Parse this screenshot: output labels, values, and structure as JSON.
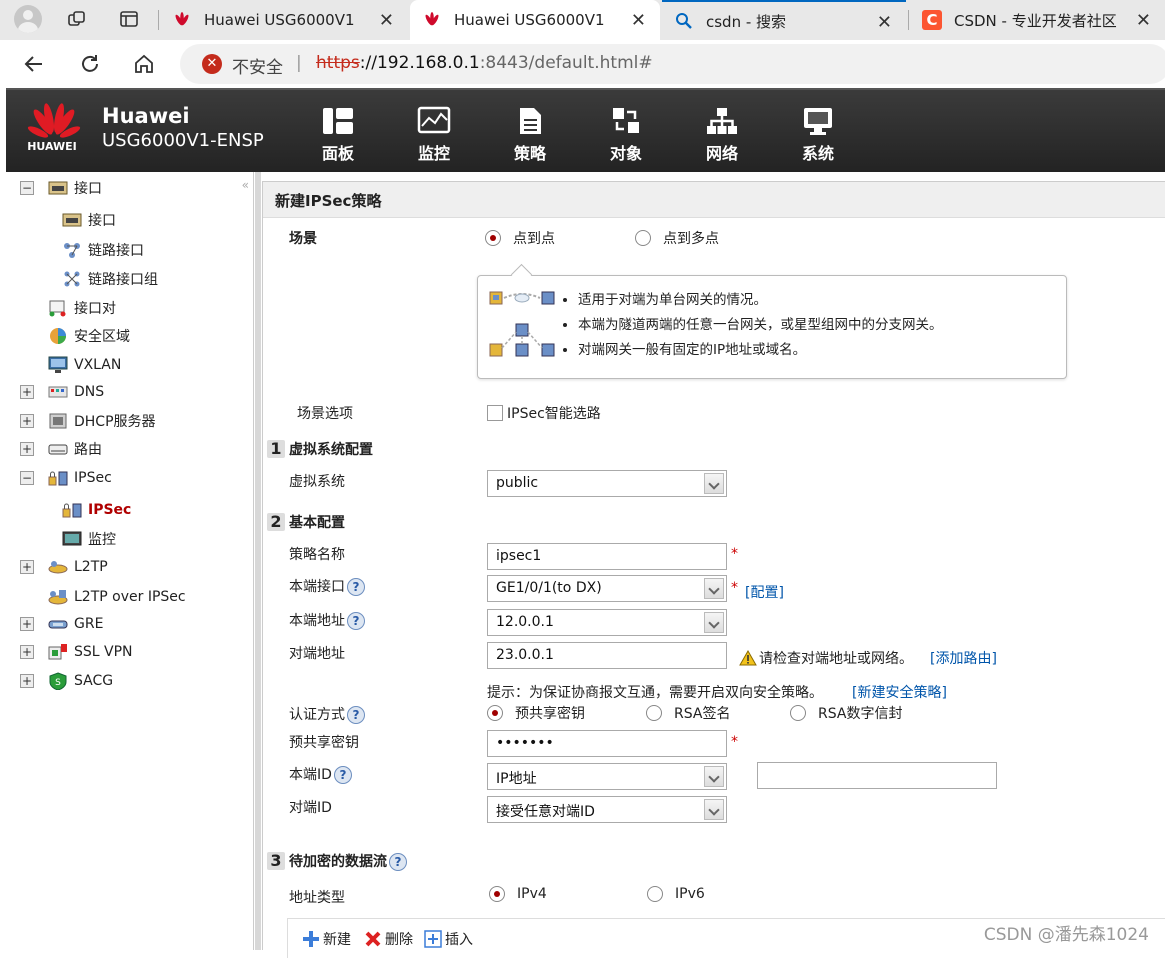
{
  "browser": {
    "tabs": [
      {
        "label": "Huawei USG6000V1",
        "active": false
      },
      {
        "label": "Huawei USG6000V1",
        "active": true
      },
      {
        "label": "csdn - 搜索",
        "active": false
      },
      {
        "label": "CSDN - 专业开发者社区",
        "active": false
      }
    ],
    "security_label": "不安全",
    "url_scheme": "https",
    "url_host": "://192.168.0.1",
    "url_rest": ":8443/default.html#"
  },
  "header": {
    "logo_text": "HUAWEI",
    "brand": "Huawei",
    "model": "USG6000V1-ENSP",
    "menu": [
      "面板",
      "监控",
      "策略",
      "对象",
      "网络",
      "系统"
    ]
  },
  "sidebar": {
    "items": [
      {
        "label": "接口"
      },
      {
        "label": "接口"
      },
      {
        "label": "链路接口"
      },
      {
        "label": "链路接口组"
      },
      {
        "label": "接口对"
      },
      {
        "label": "安全区域"
      },
      {
        "label": "VXLAN"
      },
      {
        "label": "DNS"
      },
      {
        "label": "DHCP服务器"
      },
      {
        "label": "路由"
      },
      {
        "label": "IPSec"
      },
      {
        "label": "IPSec"
      },
      {
        "label": "监控"
      },
      {
        "label": "L2TP"
      },
      {
        "label": "L2TP over IPSec"
      },
      {
        "label": "GRE"
      },
      {
        "label": "SSL VPN"
      },
      {
        "label": "SACG"
      }
    ]
  },
  "form": {
    "title": "新建IPSec策略",
    "scene_label": "场景",
    "scene_options": [
      "点到点",
      "点到多点"
    ],
    "tips": [
      "适用于对端为单台网关的情况。",
      "本端为隧道两端的任意一台网关，或星型组网中的分支网关。",
      "对端网关一般有固定的IP地址或域名。"
    ],
    "scene_option_label": "场景选项",
    "smart_route": "IPSec智能选路",
    "sec1_num": "1",
    "sec1_title": "虚拟系统配置",
    "vsys_label": "虚拟系统",
    "vsys_value": "public",
    "sec2_num": "2",
    "sec2_title": "基本配置",
    "policy_name_label": "策略名称",
    "policy_name_value": "ipsec1",
    "local_iface_label": "本端接口",
    "local_iface_value": "GE1/0/1(to DX)",
    "config_link": "[配置]",
    "local_addr_label": "本端地址",
    "local_addr_value": "12.0.0.1",
    "peer_addr_label": "对端地址",
    "peer_addr_value": "23.0.0.1",
    "peer_warn": "请检查对端地址或网络。",
    "add_route_link": "[添加路由]",
    "hint": "提示：为保证协商报文互通，需要开启双向安全策略。",
    "new_policy_link": "[新建安全策略]",
    "auth_label": "认证方式",
    "auth_options": [
      "预共享密钥",
      "RSA签名",
      "RSA数字信封"
    ],
    "psk_label": "预共享密钥",
    "psk_value": "•••••••",
    "local_id_label": "本端ID",
    "local_id_value": "IP地址",
    "peer_id_label": "对端ID",
    "peer_id_value": "接受任意对端ID",
    "sec3_num": "3",
    "sec3_title": "待加密的数据流",
    "addr_type_label": "地址类型",
    "addr_type_options": [
      "IPv4",
      "IPv6"
    ],
    "toolbar": [
      "新建",
      "删除",
      "插入"
    ],
    "required_mark": "*",
    "help_mark": "?"
  },
  "watermark": "CSDN @潘先森1024"
}
